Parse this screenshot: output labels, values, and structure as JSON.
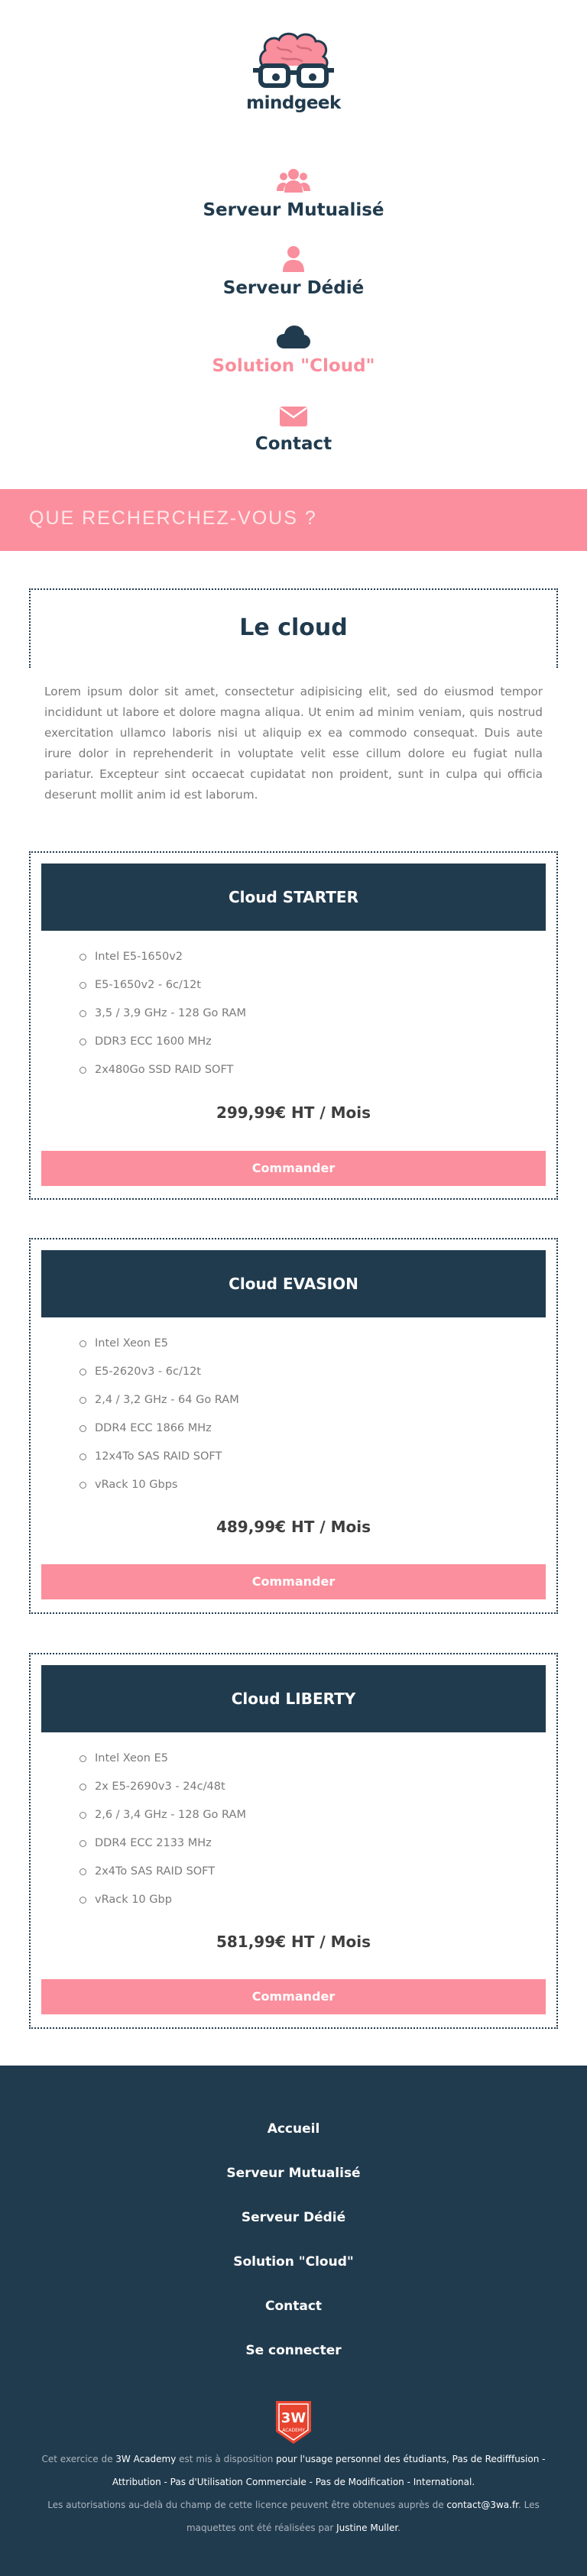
{
  "brand": {
    "name": "mindgeek"
  },
  "nav": {
    "items": [
      {
        "label": "Serveur Mutualisé",
        "icon": "users-icon"
      },
      {
        "label": "Serveur Dédié",
        "icon": "user-icon"
      },
      {
        "label": "Solution \"Cloud\"",
        "icon": "cloud-icon",
        "active": true
      },
      {
        "label": "Contact",
        "icon": "envelope-icon"
      }
    ]
  },
  "banner": {
    "text": "QUE RECHERCHEZ-VOUS ?"
  },
  "main": {
    "title": "Le cloud",
    "intro": "Lorem ipsum dolor sit amet, consectetur adipisicing elit, sed do eiusmod tempor incididunt ut labore et dolore magna aliqua. Ut enim ad minim veniam, quis nostrud exercitation ullamco laboris nisi ut aliquip ex ea commodo consequat. Duis aute irure dolor in reprehenderit in voluptate velit esse cillum dolore eu fugiat nulla pariatur. Excepteur sint occaecat cupidatat non proident, sunt in culpa qui officia deserunt mollit anim id est laborum."
  },
  "offers": [
    {
      "name": "Cloud STARTER",
      "specs": [
        "Intel E5-1650v2",
        "E5-1650v2 - 6c/12t",
        "3,5 / 3,9 GHz - 128 Go RAM",
        "DDR3 ECC 1600 MHz",
        "2x480Go SSD RAID SOFT"
      ],
      "price": "299,99€ HT / Mois",
      "button": "Commander"
    },
    {
      "name": "Cloud EVASION",
      "specs": [
        "Intel Xeon E5",
        "E5-2620v3 - 6c/12t",
        "2,4 / 3,2 GHz - 64 Go RAM",
        "DDR4 ECC 1866 MHz",
        "12x4To SAS RAID SOFT",
        "vRack 10 Gbps"
      ],
      "price": "489,99€ HT / Mois",
      "button": "Commander"
    },
    {
      "name": "Cloud LIBERTY",
      "specs": [
        "Intel Xeon E5",
        "2x E5-2690v3 - 24c/48t",
        "2,6 / 3,4 GHz - 128 Go RAM",
        "DDR4 ECC 2133 MHz",
        "2x4To SAS RAID SOFT",
        "vRack 10 Gbp"
      ],
      "price": "581,99€ HT / Mois",
      "button": "Commander"
    }
  ],
  "footer": {
    "links": [
      "Accueil",
      "Serveur Mutualisé",
      "Serveur Dédié",
      "Solution \"Cloud\"",
      "Contact",
      "Se connecter"
    ],
    "badge": {
      "top": "3W",
      "bottom": "ACADEMY"
    },
    "legal": {
      "p1": "Cet exercice de ",
      "academy": "3W Academy",
      "p2": " est mis à disposition ",
      "licence": "pour l'usage personnel des étudiants, Pas de Redifffusion - Attribution - Pas d'Utilisation Commerciale - Pas de Modification - International.",
      "p3": "Les autorisations au-delà du champ de cette licence peuvent être obtenues auprès de ",
      "email": "contact@3wa.fr",
      "p4": ". Les maquettes ont été réalisées par ",
      "author": "Justine Muller",
      "p5": "."
    }
  },
  "colors": {
    "navy": "#213b4e",
    "pink": "#fc8f9d",
    "text_grey": "#7a7a7a",
    "white": "#ffffff"
  }
}
